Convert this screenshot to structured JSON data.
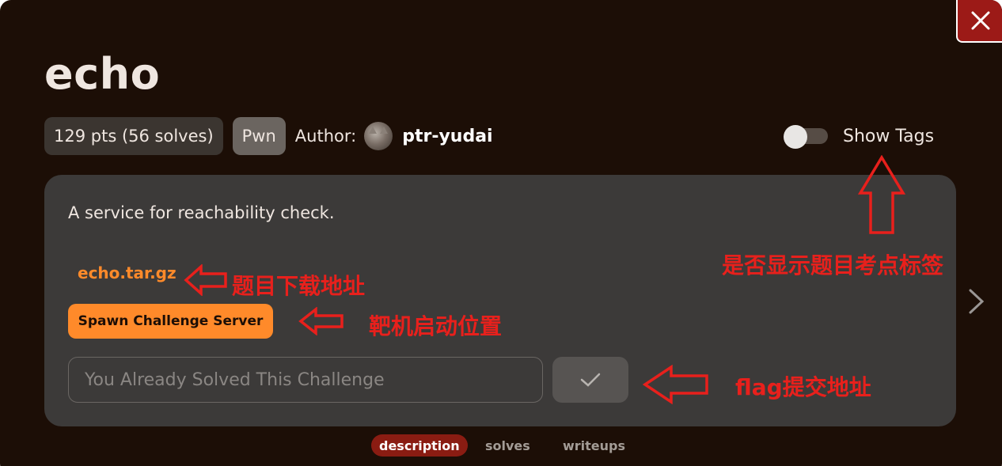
{
  "modal": {
    "title": "echo",
    "points_badge": "129 pts (56 solves)",
    "category_badge": "Pwn",
    "author_label": "Author:",
    "author_name": "ptr-yudai",
    "show_tags_label": "Show Tags",
    "show_tags_on": false,
    "description": "A service for reachability check.",
    "file_link": "echo.tar.gz",
    "spawn_button": "Spawn Challenge Server",
    "flag_input_placeholder": "You Already Solved This Challenge",
    "tabs": [
      {
        "label": "description",
        "active": true
      },
      {
        "label": "solves",
        "active": false
      },
      {
        "label": "writeups",
        "active": false
      }
    ]
  },
  "annotations": {
    "show_tags_note": "是否显示题目考点标签",
    "file_note": "题目下载地址",
    "spawn_note": "靶机启动位置",
    "flag_note": "flag提交地址"
  },
  "icons": {
    "close": "close-icon",
    "submit": "checkmark-icon",
    "next": "chevron-right-icon"
  },
  "colors": {
    "background": "#1c0e06",
    "card": "#3c3a39",
    "accent": "#ff8a2a",
    "close_button": "#9c1a17",
    "active_tab": "#8a1c12",
    "annotation": "#e8201c"
  }
}
